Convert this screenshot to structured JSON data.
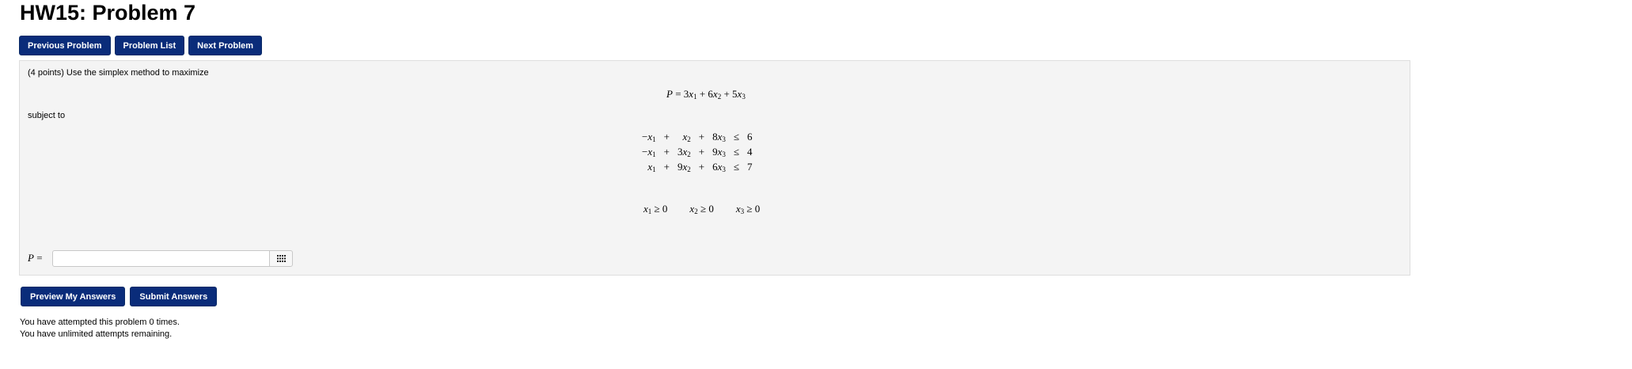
{
  "page": {
    "title": "HW15: Problem 7"
  },
  "nav": {
    "previous": "Previous Problem",
    "list": "Problem List",
    "next": "Next Problem"
  },
  "problem": {
    "statement": "(4 points) Use the simplex method to maximize",
    "objective": {
      "lhs": "P",
      "coef": [
        "3",
        "6",
        "5"
      ]
    },
    "subject_to": "subject to",
    "constraints": [
      {
        "t1": "−",
        "c1": "",
        "op1": "+",
        "c2": "",
        "op2": "+",
        "c3": "8",
        "rel": "≤",
        "rhs": "6"
      },
      {
        "t1": "−",
        "c1": "",
        "op1": "+",
        "c2": "3",
        "op2": "+",
        "c3": "9",
        "rel": "≤",
        "rhs": "4"
      },
      {
        "t1": "",
        "c1": "",
        "op1": "+",
        "c2": "9",
        "op2": "+",
        "c3": "6",
        "rel": "≤",
        "rhs": "7"
      }
    ],
    "nonnegativity": [
      "≥ 0",
      "≥ 0",
      "≥ 0"
    ],
    "answer": {
      "label": "P =",
      "value": ""
    }
  },
  "actions": {
    "preview": "Preview My Answers",
    "submit": "Submit Answers"
  },
  "attempts": {
    "line1": "You have attempted this problem 0 times.",
    "line2": "You have unlimited attempts remaining."
  },
  "colors": {
    "button": "#0a2c7a",
    "panel": "#f4f4f4"
  },
  "icons": {
    "equation_editor": "grid-icon"
  }
}
